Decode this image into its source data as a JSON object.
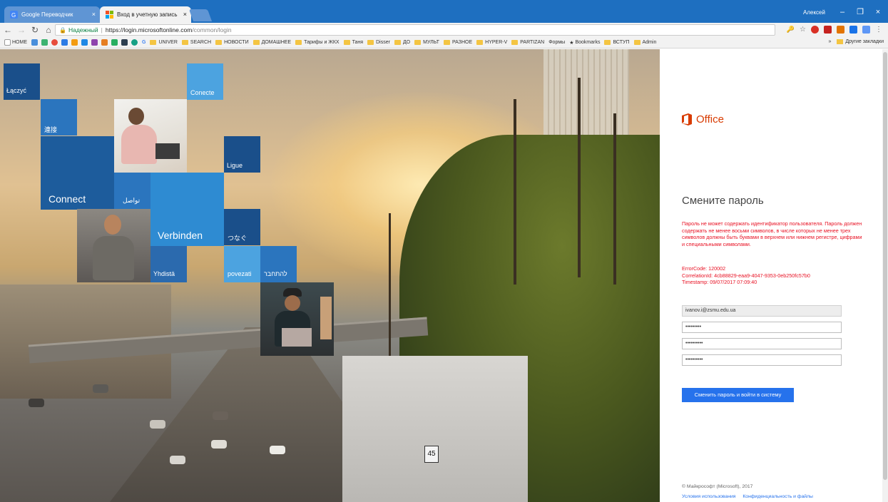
{
  "browser": {
    "tabs": [
      {
        "title": "Google Переводчик",
        "close": "×"
      },
      {
        "title": "Вход в учетную запись",
        "close": "×"
      }
    ],
    "user": "Алексей",
    "window_controls": {
      "minimize": "–",
      "maximize": "❐",
      "close": "×"
    },
    "address": {
      "secure_label": "Надежный",
      "host": "https://login.microsoftonline.com",
      "path": "/common/login"
    },
    "bookmarks": [
      "HOME",
      "G",
      "UNIVER",
      "SEARCH",
      "НОВОСТИ",
      "ДОМАШНЕЕ",
      "Тарифы и ЖКХ",
      "Таня",
      "Disser",
      "ДО",
      "МУЛЬТ",
      "РАЗНОЕ",
      "HYPER-V",
      "PARTIZAN",
      "Формы",
      "Bookmarks",
      "ВСТУП",
      "Admin"
    ],
    "bookmarks_more": "»",
    "other_bookmarks": "Другие закладки"
  },
  "hero": {
    "tiles": [
      "Łączyć",
      "連接",
      "Conecte",
      "Ligue",
      "Connect",
      "تواصل",
      "Verbinden",
      "つなぐ",
      "Yhdistä",
      "povezati",
      "להתחבר"
    ],
    "speed_sign": "45"
  },
  "panel": {
    "brand": "Office",
    "title": "Смените пароль",
    "error_message": "Пароль не может содержать идентификатор пользователя. Пароль должен содержать не менее восьми символов, в числе которых не менее трех символов должны быть буквами в верхнем или нижнем регистре, цифрами и специальными символами.",
    "error_code": "ErrorCode: 120002",
    "correlation_id": "CorrelationId: 4cb88829-eaa9-4047-9353-0eb250fc57b0",
    "timestamp": "Timestamp: 09/07/2017 07:09:40",
    "user_id": "ivanov.i@zsmu.edu.ua",
    "old_password": "•••••••••",
    "new_password": "••••••••••",
    "confirm_password": "••••••••••",
    "submit": "Сменить пароль и войти в систему",
    "copyright": "© Майкрософт (Microsoft), 2017",
    "footer_links": [
      "Условия использования",
      "Конфиденциальность и файлы"
    ]
  },
  "colors": {
    "accent": "#2672ec",
    "brand": "#d83b01",
    "error": "#e81123",
    "titlebar": "#1e6fc0"
  }
}
